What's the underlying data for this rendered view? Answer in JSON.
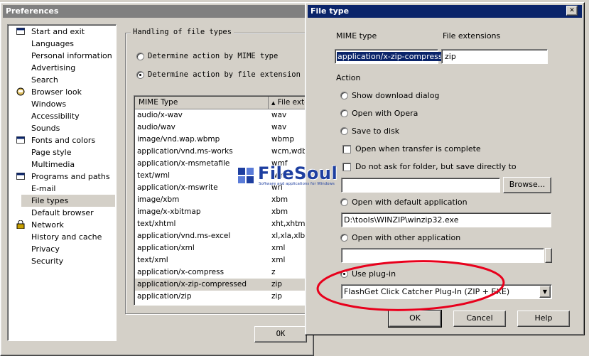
{
  "preferences": {
    "title": "Preferences",
    "nav": [
      {
        "label": "Start and exit",
        "icon": "folder-icon"
      },
      {
        "label": "Languages",
        "icon": ""
      },
      {
        "label": "Personal information",
        "icon": ""
      },
      {
        "label": "Advertising",
        "icon": ""
      },
      {
        "label": "Search",
        "icon": ""
      },
      {
        "label": "Browser look",
        "icon": "browser-look-icon"
      },
      {
        "label": "Windows",
        "icon": ""
      },
      {
        "label": "Accessibility",
        "icon": ""
      },
      {
        "label": "Sounds",
        "icon": ""
      },
      {
        "label": "Fonts and colors",
        "icon": "folder-icon"
      },
      {
        "label": "Page style",
        "icon": ""
      },
      {
        "label": "Multimedia",
        "icon": ""
      },
      {
        "label": "Programs and paths",
        "icon": "folder-icon"
      },
      {
        "label": "E-mail",
        "icon": ""
      },
      {
        "label": "File types",
        "icon": ""
      },
      {
        "label": "Default browser",
        "icon": ""
      },
      {
        "label": "Network",
        "icon": "lock-icon"
      },
      {
        "label": "History and cache",
        "icon": ""
      },
      {
        "label": "Privacy",
        "icon": ""
      },
      {
        "label": "Security",
        "icon": ""
      }
    ],
    "handling_group_label": "Handling of file types",
    "radio_mime": "Determine action by MIME type",
    "radio_ext": "Determine action by file extension if",
    "table": {
      "headers": [
        "MIME Type",
        "File exte"
      ],
      "rows": [
        [
          "audio/x-wav",
          "wav"
        ],
        [
          "audio/wav",
          "wav"
        ],
        [
          "image/vnd.wap.wbmp",
          "wbmp"
        ],
        [
          "application/vnd.ms-works",
          "wcm,wdb,"
        ],
        [
          "application/x-msmetafile",
          "wmf"
        ],
        [
          "text/wml",
          "wml"
        ],
        [
          "application/x-mswrite",
          "wri"
        ],
        [
          "image/xbm",
          "xbm"
        ],
        [
          "image/x-xbitmap",
          "xbm"
        ],
        [
          "text/xhtml",
          "xht,xhtm,"
        ],
        [
          "application/vnd.ms-excel",
          "xl,xla,xlb,"
        ],
        [
          "application/xml",
          "xml"
        ],
        [
          "text/xml",
          "xml"
        ],
        [
          "application/x-compress",
          "z"
        ],
        [
          "application/x-zip-compressed",
          "zip"
        ],
        [
          "application/zip",
          "zip"
        ]
      ]
    },
    "ok_label": "OK"
  },
  "filetype": {
    "title": "File type",
    "close_glyph": "✕",
    "mime_label": "MIME type",
    "ext_label": "File extensions",
    "mime_value": "application/x-zip-compressed",
    "ext_value": "zip",
    "action_label": "Action",
    "opt_show": "Show download dialog",
    "opt_opera": "Open with Opera",
    "opt_save": "Save to disk",
    "chk_open_when": "Open when transfer is complete",
    "chk_no_ask": "Do not ask for folder, but save directly to",
    "save_path": "",
    "browse_label": "Browse...",
    "opt_default_app": "Open with default application",
    "default_app_path": "D:\\tools\\WINZIP\\winzip32.exe",
    "opt_other_app": "Open with other application",
    "other_app_path": "",
    "opt_plugin": "Use plug-in",
    "plugin_value": "FlashGet Click Catcher Plug-In (ZIP + EXE)",
    "ok_label": "OK",
    "cancel_label": "Cancel",
    "help_label": "Help"
  },
  "watermark": {
    "name": "FileSoul",
    "tagline": "Software and applications for Windows"
  },
  "colors": {
    "title_active": "#0a246a",
    "title_inactive": "#808080",
    "annotation_red": "#e8001c",
    "window_bg": "#d4d0c8",
    "selection": "#0a246a"
  }
}
